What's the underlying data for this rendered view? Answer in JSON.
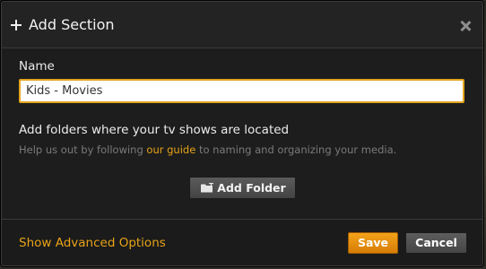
{
  "dialog": {
    "title": "Add Section",
    "icons": {
      "title_icon": "plus-icon",
      "close": "close-icon",
      "folder": "folder-icon"
    }
  },
  "name_field": {
    "label": "Name",
    "value": "Kids - Movies"
  },
  "folders": {
    "heading": "Add folders where your tv shows are located",
    "help_prefix": "Help us out by following ",
    "help_link": "our guide",
    "help_suffix": " to naming and organizing your media.",
    "add_button": "Add Folder"
  },
  "footer": {
    "advanced_link": "Show Advanced Options",
    "save_label": "Save",
    "cancel_label": "Cancel"
  },
  "colors": {
    "accent": "#e8a317",
    "dialog_bg": "#1d1d1d",
    "input_border": "#e3a51f"
  }
}
